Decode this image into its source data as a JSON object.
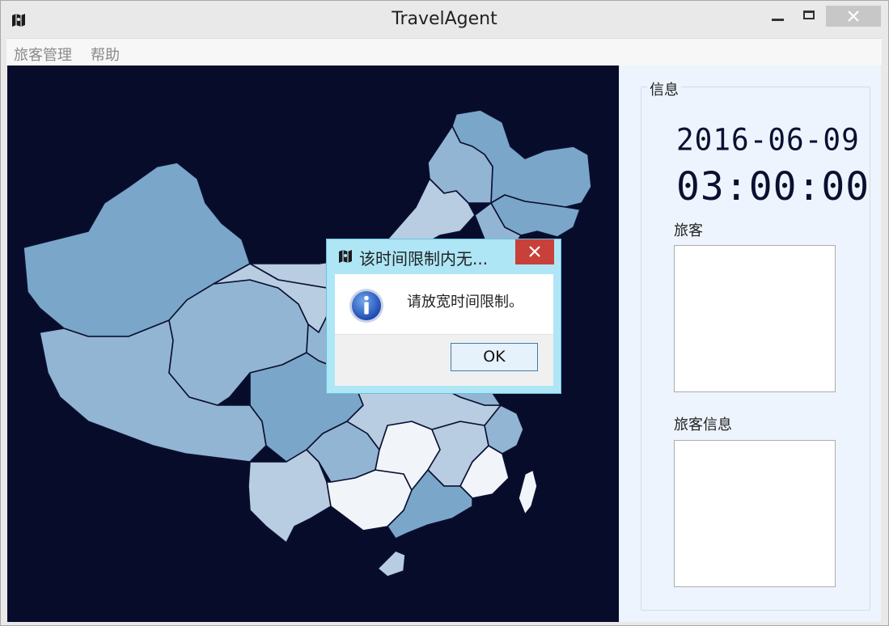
{
  "window": {
    "title": "TravelAgent"
  },
  "menu": [
    {
      "label": "旅客管理"
    },
    {
      "label": "帮助"
    }
  ],
  "info_panel": {
    "group_title": "信息",
    "date": "2016-06-09",
    "time": "03:00:00",
    "traveler_label": "旅客",
    "traveler_info_label": "旅客信息"
  },
  "dialog": {
    "title": "该时间限制内无...",
    "message": "请放宽时间限制。",
    "ok_label": "OK",
    "icon": "info-icon"
  },
  "map": {
    "background_color": "#070c2b",
    "region_colors": [
      "#7aa6c9",
      "#93b5d4",
      "#b8cce2",
      "#f1f5f9"
    ]
  }
}
